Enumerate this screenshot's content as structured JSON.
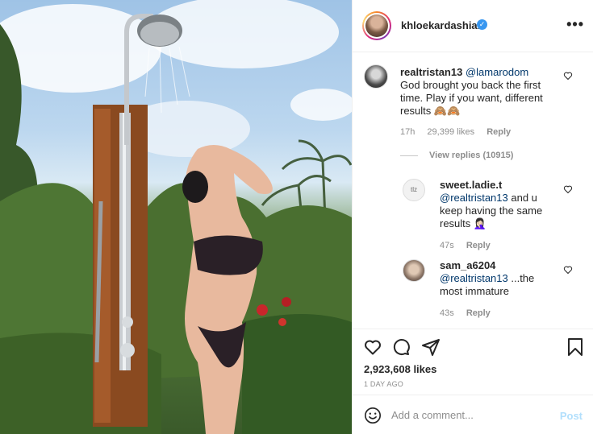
{
  "post": {
    "owner": {
      "username": "khloekardashian",
      "verified": true,
      "avatar": "avatar-photo"
    },
    "more_icon": "more-options-icon",
    "image": "outdoor-shower-photo",
    "likes": "2,923,608 likes",
    "age": "1 DAY AGO"
  },
  "comments": [
    {
      "username": "realtristan13",
      "mention": "@lamarodom",
      "text_line1": "God brought you back the first",
      "text_line2": "time. Play if you want, different",
      "text_line3": "results 🙈🙈",
      "time": "17h",
      "likes": "29,399 likes",
      "reply": "Reply",
      "view_replies": "View replies (10915)"
    },
    {
      "username": "sweet.ladie.t",
      "mention": "@realtristan13",
      "text_line1_rest": " and u",
      "text_line2": "keep having the same",
      "text_line3": "results 🤦🏻‍♀️",
      "time": "47s",
      "reply": "Reply"
    },
    {
      "username": "sam_a6204",
      "mention": "@realtristan13",
      "text_rest": " ...the",
      "text_line2": "most immature",
      "time": "43s",
      "reply": "Reply"
    }
  ],
  "add_comment": {
    "placeholder": "Add a comment...",
    "post_label": "Post"
  },
  "colors": {
    "link": "#00376b",
    "verified": "#3897f0",
    "muted": "#8e8e8e",
    "post_disabled": "#b2dffc"
  }
}
